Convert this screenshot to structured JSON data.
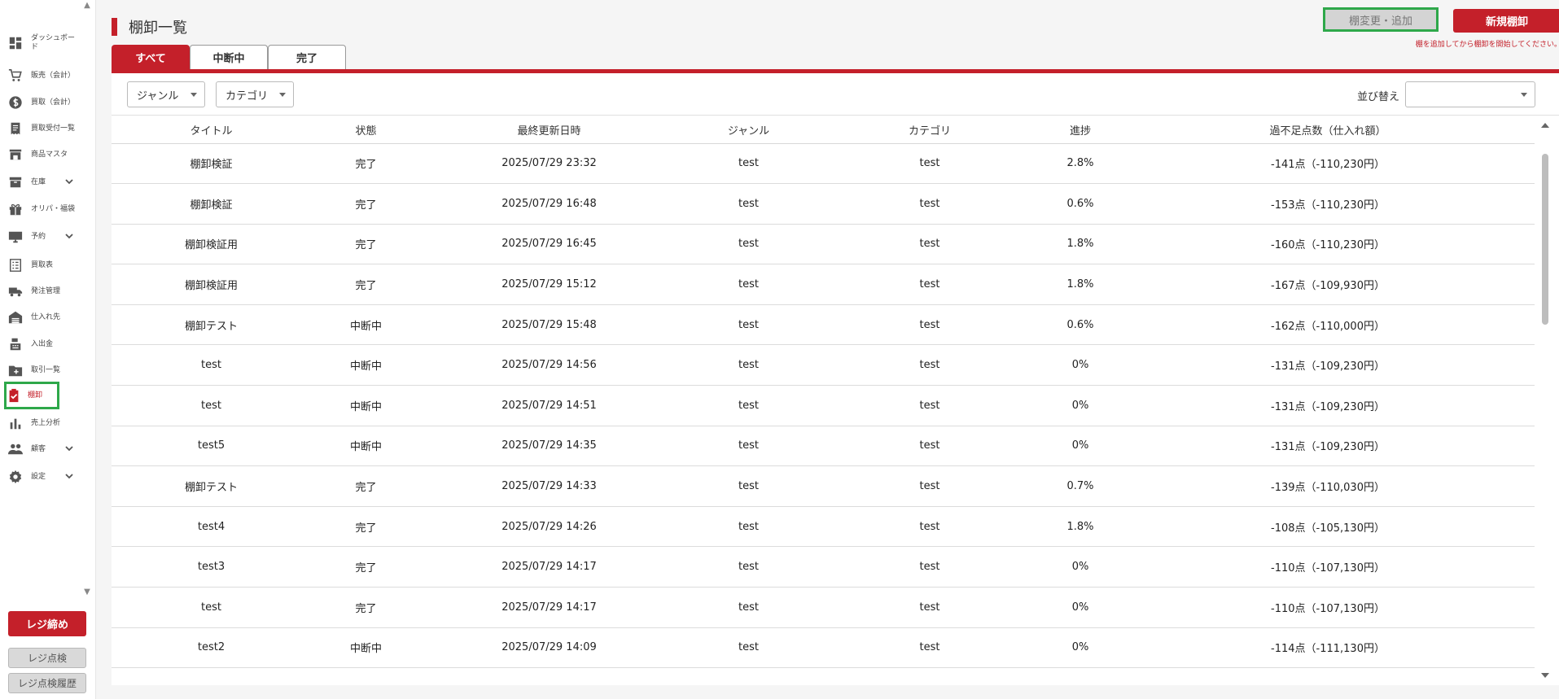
{
  "sidebar": {
    "items": [
      {
        "label": "ダッシュボード",
        "icon": "dashboard-icon"
      },
      {
        "label": "販売（会計）",
        "icon": "cart-icon"
      },
      {
        "label": "買取（会計）",
        "icon": "dollar-icon"
      },
      {
        "label": "買取受付一覧",
        "icon": "receipt-icon"
      },
      {
        "label": "商品マスタ",
        "icon": "store-icon"
      },
      {
        "label": "在庫",
        "icon": "archive-icon"
      },
      {
        "label": "オリパ・福袋",
        "icon": "gift-icon"
      },
      {
        "label": "予約",
        "icon": "monitor-icon"
      },
      {
        "label": "買取表",
        "icon": "list-icon"
      },
      {
        "label": "発注管理",
        "icon": "truck-icon"
      },
      {
        "label": "仕入れ先",
        "icon": "warehouse-icon"
      },
      {
        "label": "入出金",
        "icon": "register-icon"
      },
      {
        "label": "取引一覧",
        "icon": "folder-icon"
      },
      {
        "label": "棚卸",
        "icon": "clipboard-check-icon"
      },
      {
        "label": "売上分析",
        "icon": "bar-chart-icon"
      },
      {
        "label": "顧客",
        "icon": "people-icon"
      },
      {
        "label": "設定",
        "icon": "gear-icon"
      }
    ],
    "close_register": "レジ締め",
    "register_check": "レジ点検",
    "register_check_history": "レジ点検履歴"
  },
  "header": {
    "title": "棚卸一覧",
    "change_button": "棚変更・追加",
    "new_button": "新規棚卸",
    "hint": "棚を追加してから棚卸を開始してください。"
  },
  "tabs": [
    "すべて",
    "中断中",
    "完了"
  ],
  "filters": {
    "genre": "ジャンル",
    "category": "カテゴリ",
    "sort_label": "並び替え",
    "sort_value": ""
  },
  "table": {
    "columns": [
      "タイトル",
      "状態",
      "最終更新日時",
      "ジャンル",
      "カテゴリ",
      "進捗",
      "過不足点数（仕入れ額）"
    ],
    "rows": [
      [
        "棚卸検証",
        "完了",
        "2025/07/29 23:32",
        "test",
        "test",
        "2.8%",
        "-141点（-110,230円）"
      ],
      [
        "棚卸検証",
        "完了",
        "2025/07/29 16:48",
        "test",
        "test",
        "0.6%",
        "-153点（-110,230円）"
      ],
      [
        "棚卸検証用",
        "完了",
        "2025/07/29 16:45",
        "test",
        "test",
        "1.8%",
        "-160点（-110,230円）"
      ],
      [
        "棚卸検証用",
        "完了",
        "2025/07/29 15:12",
        "test",
        "test",
        "1.8%",
        "-167点（-109,930円）"
      ],
      [
        "棚卸テスト",
        "中断中",
        "2025/07/29 15:48",
        "test",
        "test",
        "0.6%",
        "-162点（-110,000円）"
      ],
      [
        "test",
        "中断中",
        "2025/07/29 14:56",
        "test",
        "test",
        "0%",
        "-131点（-109,230円）"
      ],
      [
        "test",
        "中断中",
        "2025/07/29 14:51",
        "test",
        "test",
        "0%",
        "-131点（-109,230円）"
      ],
      [
        "test5",
        "中断中",
        "2025/07/29 14:35",
        "test",
        "test",
        "0%",
        "-131点（-109,230円）"
      ],
      [
        "棚卸テスト",
        "完了",
        "2025/07/29 14:33",
        "test",
        "test",
        "0.7%",
        "-139点（-110,030円）"
      ],
      [
        "test4",
        "完了",
        "2025/07/29 14:26",
        "test",
        "test",
        "1.8%",
        "-108点（-105,130円）"
      ],
      [
        "test3",
        "完了",
        "2025/07/29 14:17",
        "test",
        "test",
        "0%",
        "-110点（-107,130円）"
      ],
      [
        "test",
        "完了",
        "2025/07/29 14:17",
        "test",
        "test",
        "0%",
        "-110点（-107,130円）"
      ],
      [
        "test2",
        "中断中",
        "2025/07/29 14:09",
        "test",
        "test",
        "0%",
        "-114点（-111,130円）"
      ]
    ]
  },
  "colors": {
    "accent": "#c4202a",
    "highlight": "#2ea84a"
  }
}
